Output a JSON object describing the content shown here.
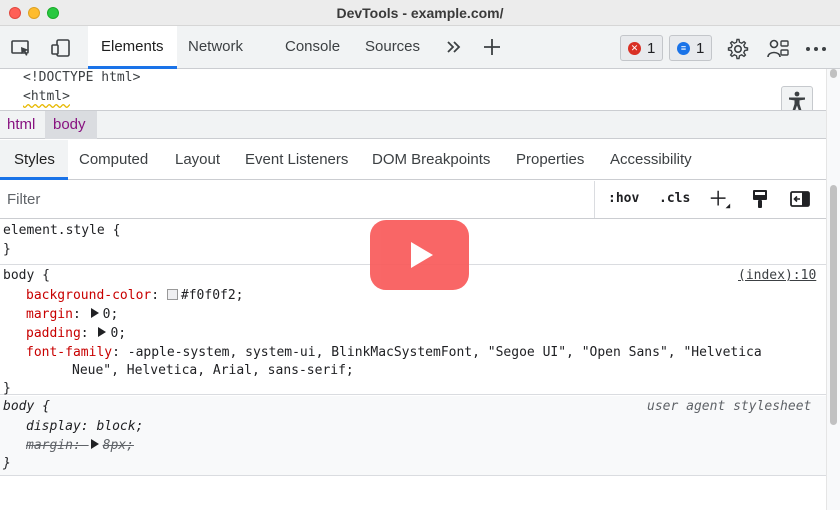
{
  "window": {
    "title": "DevTools - example.com/"
  },
  "toolbar": {
    "tabs": [
      "Elements",
      "Network",
      "Console",
      "Sources"
    ],
    "active_tab": "Elements",
    "more_tabs_icon": "double-chevron-right-icon",
    "add_tab_icon": "plus-icon",
    "error_count": "1",
    "message_count": "1",
    "icons": [
      "inspect-icon",
      "device-toolbar-icon",
      "settings-gear-icon",
      "customize-icon",
      "more-menu-icon"
    ]
  },
  "dom": {
    "lines": [
      "<!DOCTYPE html>",
      "<html>"
    ]
  },
  "breadcrumb": {
    "items": [
      "html",
      "body"
    ],
    "selected": "body"
  },
  "styles_tabs": {
    "items": [
      "Styles",
      "Computed",
      "Layout",
      "Event Listeners",
      "DOM Breakpoints",
      "Properties",
      "Accessibility"
    ],
    "active": "Styles"
  },
  "filter": {
    "placeholder": "Filter",
    "hov": ":hov",
    "cls": ".cls"
  },
  "rules": {
    "element_style": {
      "selector": "element.style {",
      "close": "}"
    },
    "body_rule": {
      "selector": "body {",
      "source": "(index):10",
      "props": [
        {
          "name": "background-color",
          "value": "#f0f0f2;"
        },
        {
          "name": "margin",
          "value": "0;"
        },
        {
          "name": "padding",
          "value": "0;"
        },
        {
          "name": "font-family",
          "value": "-apple-system, system-ui, BlinkMacSystemFont, \"Segoe UI\", \"Open Sans\", \"Helvetica",
          "value_cont": "Neue\", Helvetica, Arial, sans-serif;"
        }
      ],
      "close": "}"
    },
    "ua_rule": {
      "selector": "body {",
      "source": "user agent stylesheet",
      "props": [
        {
          "name": "display",
          "value": "block;"
        },
        {
          "name": "margin",
          "value": "8px;"
        }
      ],
      "close": "}"
    }
  },
  "colors": {
    "accent": "#1a73e8",
    "error": "#d93025",
    "info": "#1a73e8",
    "play_overlay": "#f95a5a",
    "swatch": "#f0f0f2"
  }
}
